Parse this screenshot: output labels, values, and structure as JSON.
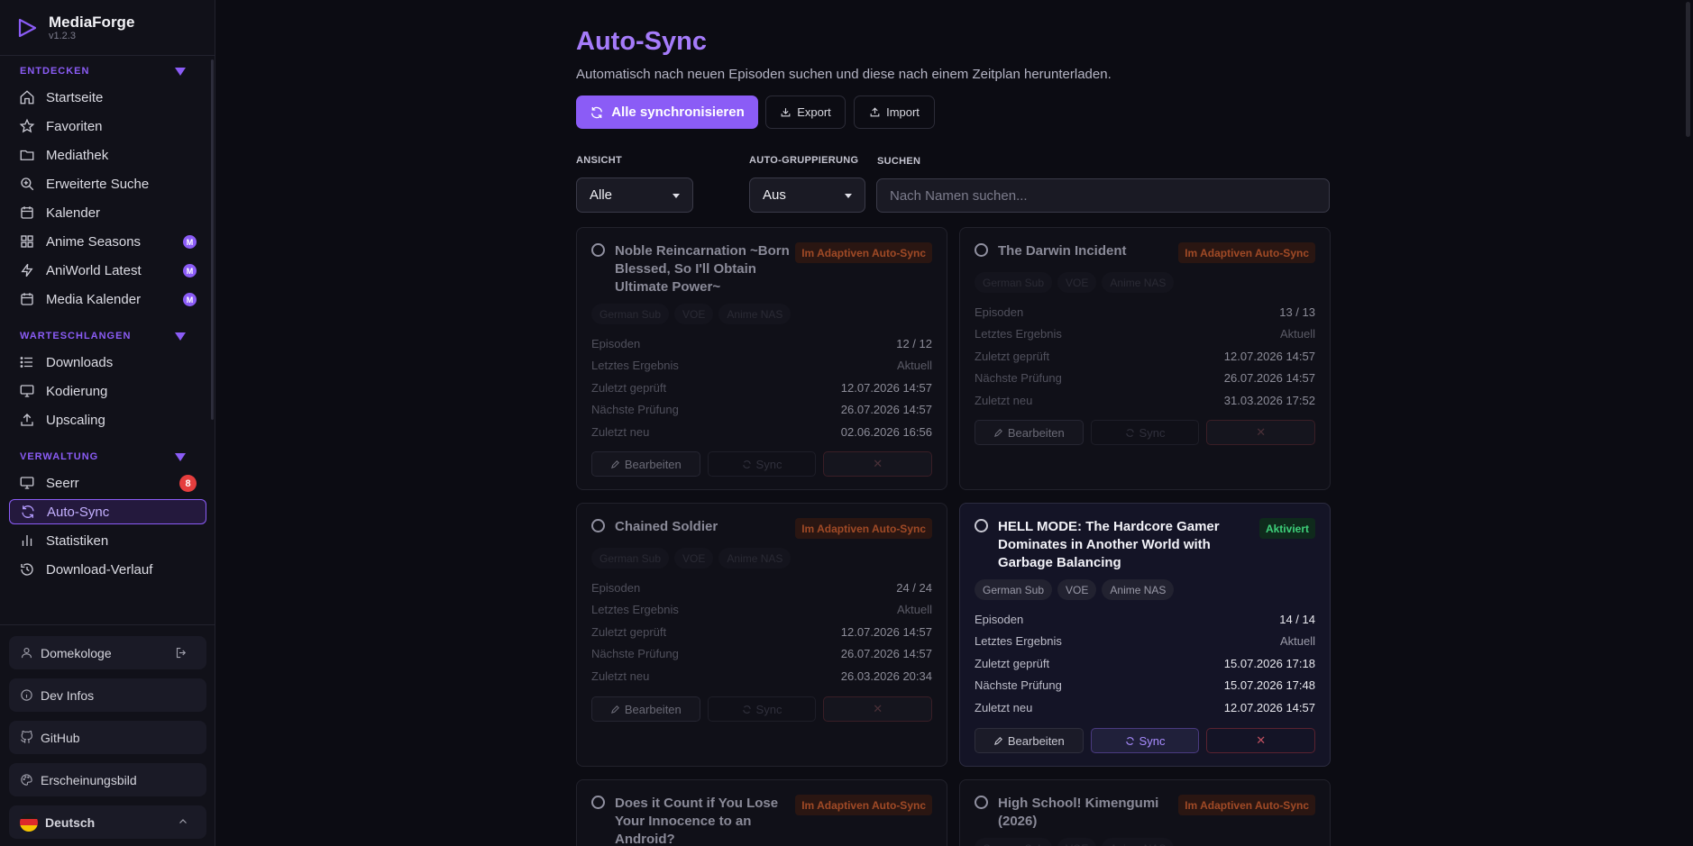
{
  "app": {
    "name": "MediaForge",
    "version": "v1.2.3"
  },
  "sidebar": {
    "sections": [
      {
        "title": "ENTDECKEN",
        "items": [
          {
            "label": "Startseite"
          },
          {
            "label": "Favoriten"
          },
          {
            "label": "Mediathek"
          },
          {
            "label": "Erweiterte Suche"
          },
          {
            "label": "Kalender"
          },
          {
            "label": "Anime Seasons",
            "badge": "M"
          },
          {
            "label": "AniWorld Latest",
            "badge": "M"
          },
          {
            "label": "Media Kalender",
            "badge": "M"
          }
        ]
      },
      {
        "title": "WARTESCHLANGEN",
        "items": [
          {
            "label": "Downloads"
          },
          {
            "label": "Kodierung"
          },
          {
            "label": "Upscaling"
          }
        ]
      },
      {
        "title": "VERWALTUNG",
        "items": [
          {
            "label": "Seerr",
            "count": "8"
          },
          {
            "label": "Auto-Sync"
          },
          {
            "label": "Statistiken"
          },
          {
            "label": "Download-Verlauf"
          }
        ]
      }
    ],
    "bottom": {
      "user": "Domekologe",
      "dev_infos": "Dev Infos",
      "github": "GitHub",
      "appearance": "Erscheinungsbild",
      "language": "Deutsch"
    }
  },
  "page": {
    "title": "Auto-Sync",
    "subtitle": "Automatisch nach neuen Episoden suchen und diese nach einem Zeitplan herunterladen.",
    "sync_all": "Alle synchronisieren",
    "export": "Export",
    "import": "Import",
    "filters": {
      "view_label": "ANSICHT",
      "view_value": "Alle",
      "group_label": "AUTO-GRUPPIERUNG",
      "group_value": "Aus",
      "search_label": "SUCHEN",
      "search_placeholder": "Nach Namen suchen..."
    },
    "row_labels": {
      "episodes": "Episoden",
      "last_result": "Letztes Ergebnis",
      "last_checked": "Zuletzt geprüft",
      "next_check": "Nächste Prüfung",
      "last_new": "Zuletzt neu"
    },
    "action_labels": {
      "edit": "Bearbeiten",
      "sync": "Sync",
      "delete": "✕"
    },
    "cards": [
      {
        "title": "Noble Reincarnation ~Born Blessed, So I'll Obtain Ultimate Power~",
        "status": "Im Adaptiven Auto-Sync",
        "tags": [
          "German Sub",
          "VOE",
          "Anime NAS"
        ],
        "episodes": "12 / 12",
        "last_result": "Aktuell",
        "last_checked": "12.07.2026 14:57",
        "next_check": "26.07.2026 14:57",
        "last_new": "02.06.2026 16:56"
      },
      {
        "title": "The Darwin Incident",
        "status": "Im Adaptiven Auto-Sync",
        "tags": [
          "German Sub",
          "VOE",
          "Anime NAS"
        ],
        "episodes": "13 / 13",
        "last_result": "Aktuell",
        "last_checked": "12.07.2026 14:57",
        "next_check": "26.07.2026 14:57",
        "last_new": "31.03.2026 17:52"
      },
      {
        "title": "Chained Soldier",
        "status": "Im Adaptiven Auto-Sync",
        "tags": [
          "German Sub",
          "VOE",
          "Anime NAS"
        ],
        "episodes": "24 / 24",
        "last_result": "Aktuell",
        "last_checked": "12.07.2026 14:57",
        "next_check": "26.07.2026 14:57",
        "last_new": "26.03.2026 20:34"
      },
      {
        "title": "HELL MODE: The Hardcore Gamer Dominates in Another World with Garbage Balancing",
        "status": "Aktiviert",
        "tags": [
          "German Sub",
          "VOE",
          "Anime NAS"
        ],
        "episodes": "14 / 14",
        "last_result": "Aktuell",
        "last_checked": "15.07.2026 17:18",
        "next_check": "15.07.2026 17:48",
        "last_new": "12.07.2026 14:57"
      },
      {
        "title": "Does it Count if You Lose Your Innocence to an Android?",
        "status": "Im Adaptiven Auto-Sync"
      },
      {
        "title": "High School! Kimengumi (2026)",
        "status": "Im Adaptiven Auto-Sync",
        "tags": [
          "German Sub",
          "VOE",
          "Anime NAS"
        ]
      }
    ]
  },
  "colors": {
    "accent": "#8b5cf6",
    "warning_text": "#a04a26",
    "success_text": "#3ed07a",
    "danger_badge": "#e53e3e"
  }
}
